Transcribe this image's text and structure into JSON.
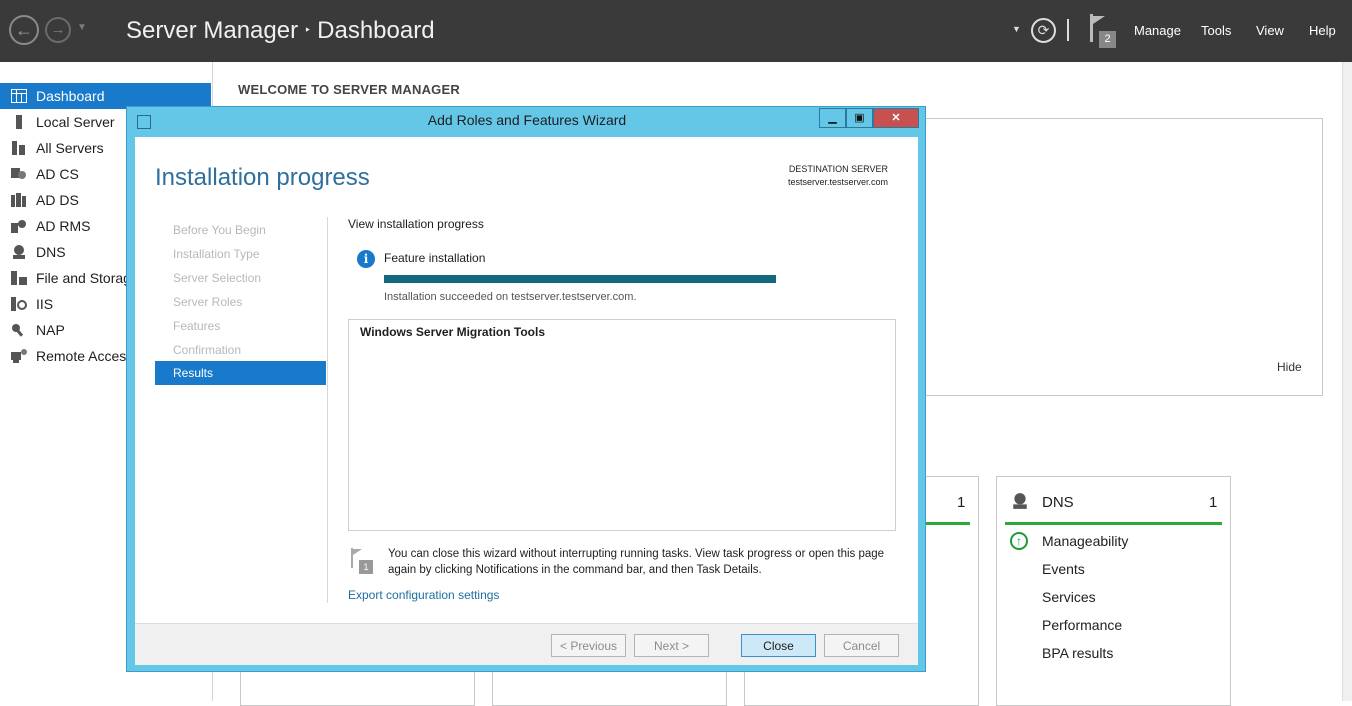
{
  "titlebar": {
    "app": "Server Manager",
    "separator": "‣",
    "page": "Dashboard",
    "notification_count": "2",
    "menu": [
      "Manage",
      "Tools",
      "View",
      "Help"
    ]
  },
  "sidebar": {
    "items": [
      {
        "label": "Dashboard",
        "icon": "dashboard-icon"
      },
      {
        "label": "Local Server",
        "icon": "server-icon"
      },
      {
        "label": "All Servers",
        "icon": "servers-icon"
      },
      {
        "label": "AD CS",
        "icon": "ad-cs-icon"
      },
      {
        "label": "AD DS",
        "icon": "ad-ds-icon"
      },
      {
        "label": "AD RMS",
        "icon": "ad-rms-icon"
      },
      {
        "label": "DNS",
        "icon": "dns-icon"
      },
      {
        "label": "File and Storage Services",
        "icon": "file-storage-icon"
      },
      {
        "label": "IIS",
        "icon": "iis-icon"
      },
      {
        "label": "NAP",
        "icon": "nap-icon"
      },
      {
        "label": "Remote Access",
        "icon": "remote-access-icon"
      }
    ]
  },
  "main": {
    "welcome": "WELCOME TO SERVER MANAGER",
    "hide": "Hide",
    "tile_count": "1",
    "dns_tile": {
      "title": "DNS",
      "count": "1",
      "items": [
        "Manageability",
        "Events",
        "Services",
        "Performance",
        "BPA results"
      ]
    }
  },
  "wizard": {
    "title": "Add Roles and Features Wizard",
    "heading": "Installation progress",
    "destination_label": "DESTINATION SERVER",
    "destination_value": "testserver.testserver.com",
    "steps": [
      "Before You Begin",
      "Installation Type",
      "Server Selection",
      "Server Roles",
      "Features",
      "Confirmation",
      "Results"
    ],
    "lead": "View installation progress",
    "feature_label": "Feature installation",
    "progress_percent": 100,
    "success": "Installation succeeded on testserver.testserver.com.",
    "results_item": "Windows Server Migration Tools",
    "notification_count": "1",
    "note": "You can close this wizard without interrupting running tasks. View task progress or open this page again by clicking Notifications in the command bar, and then Task Details.",
    "export": "Export configuration settings",
    "buttons": {
      "previous": "< Previous",
      "next": "Next >",
      "close": "Close",
      "cancel": "Cancel"
    }
  }
}
